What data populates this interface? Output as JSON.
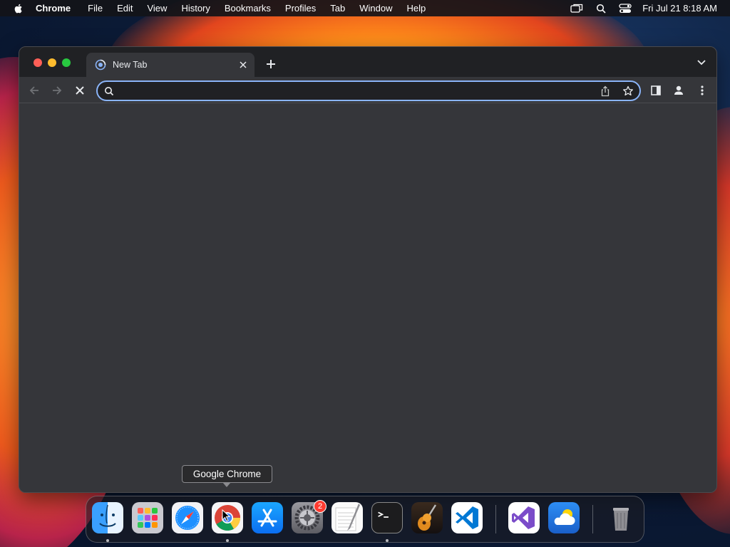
{
  "menubar": {
    "app_name": "Chrome",
    "items": [
      "File",
      "Edit",
      "View",
      "History",
      "Bookmarks",
      "Profiles",
      "Tab",
      "Window",
      "Help"
    ],
    "clock": "Fri Jul 21  8:18 AM"
  },
  "browser": {
    "tab": {
      "title": "New Tab"
    },
    "omnibox": {
      "value": "",
      "placeholder": ""
    }
  },
  "tooltip": {
    "text": "Google Chrome"
  },
  "dock": {
    "items": [
      "Finder",
      "Launchpad",
      "Safari",
      "Google Chrome",
      "App Store",
      "System Settings",
      "TextEdit",
      "Terminal",
      "GarageBand",
      "Visual Studio Code",
      "Visual Studio",
      "Weather",
      "Trash"
    ],
    "settings_badge": "2"
  },
  "colors": {
    "accent": "#8ab4f8",
    "tabstrip": "#202124",
    "window_bg": "#35363a"
  }
}
